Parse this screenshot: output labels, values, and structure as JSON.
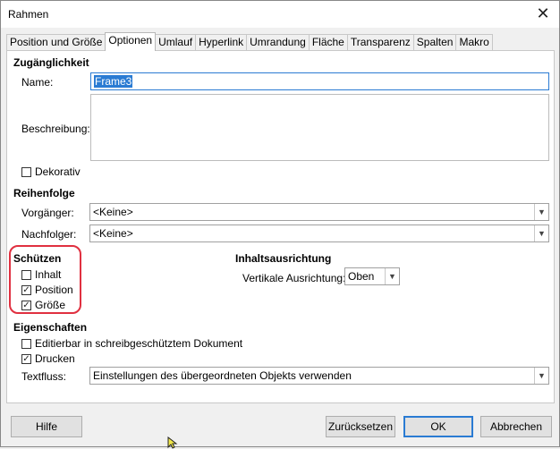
{
  "window": {
    "title": "Rahmen"
  },
  "tabs": [
    {
      "label": "Position und Größe"
    },
    {
      "label": "Optionen"
    },
    {
      "label": "Umlauf"
    },
    {
      "label": "Hyperlink"
    },
    {
      "label": "Umrandung"
    },
    {
      "label": "Fläche"
    },
    {
      "label": "Transparenz"
    },
    {
      "label": "Spalten"
    },
    {
      "label": "Makro"
    }
  ],
  "accessibility": {
    "section_title": "Zugänglichkeit",
    "name_label": "Name:",
    "name_value": "Frame3",
    "description_label": "Beschreibung:",
    "description_value": "",
    "decorative_label": "Dekorativ",
    "decorative_checked": false
  },
  "order": {
    "section_title": "Reihenfolge",
    "previous_label": "Vorgänger:",
    "previous_value": "<Keine>",
    "next_label": "Nachfolger:",
    "next_value": "<Keine>"
  },
  "protect": {
    "section_title": "Schützen",
    "content_label": "Inhalt",
    "content_checked": false,
    "position_label": "Position",
    "position_checked": true,
    "size_label": "Größe",
    "size_checked": true,
    "highlight_color": "#e03040"
  },
  "alignment": {
    "section_title": "Inhaltsausrichtung",
    "vertical_label": "Vertikale Ausrichtung:",
    "vertical_value": "Oben"
  },
  "properties": {
    "section_title": "Eigenschaften",
    "editable_label": "Editierbar in schreibgeschütztem Dokument",
    "editable_checked": false,
    "print_label": "Drucken",
    "print_checked": true,
    "textflow_label": "Textfluss:",
    "textflow_value": "Einstellungen des übergeordneten Objekts verwenden"
  },
  "buttons": {
    "help": "Hilfe",
    "reset": "Zurücksetzen",
    "ok": "OK",
    "cancel": "Abbrechen"
  },
  "colors": {
    "accent": "#2a7bd3"
  }
}
